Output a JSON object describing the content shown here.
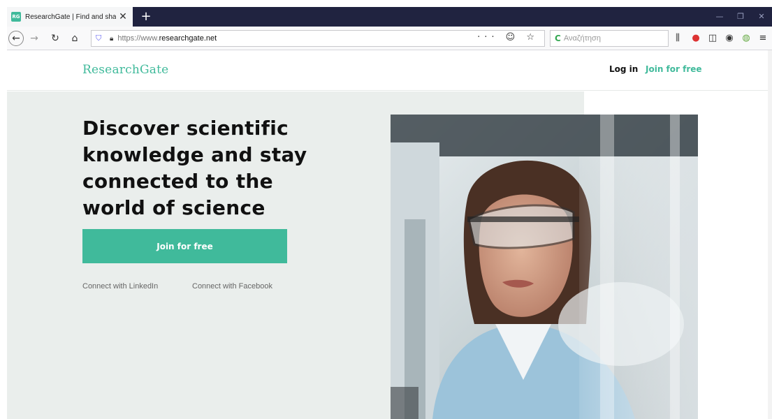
{
  "browser": {
    "tab_title": "ResearchGate | Find and share",
    "tab_favicon": "RG",
    "url_prefix": "https://www.",
    "url_domain": "researchgate.net",
    "search_placeholder": "Αναζήτηση",
    "new_tab_label": "+",
    "url_actions": "··· ☺ ☆"
  },
  "header": {
    "brand": "ResearchGate",
    "login": "Log in",
    "join": "Join for free"
  },
  "hero": {
    "title": "Discover scientific knowledge and stay connected to the world of science",
    "cta": "Join for free",
    "connect_linkedin": "Connect with LinkedIn",
    "connect_facebook": "Connect with Facebook"
  },
  "colors": {
    "brand": "#40ba9b",
    "hero_bg": "#eaeeec",
    "tabbar": "#202340"
  }
}
